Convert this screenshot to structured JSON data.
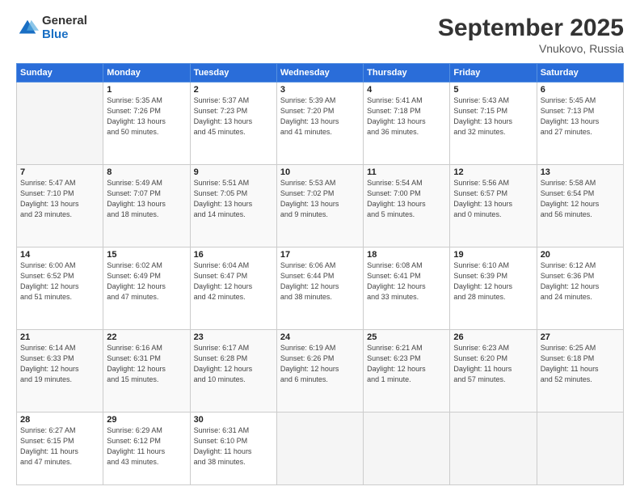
{
  "header": {
    "logo_general": "General",
    "logo_blue": "Blue",
    "month_title": "September 2025",
    "location": "Vnukovo, Russia"
  },
  "days_of_week": [
    "Sunday",
    "Monday",
    "Tuesday",
    "Wednesday",
    "Thursday",
    "Friday",
    "Saturday"
  ],
  "weeks": [
    [
      {
        "day": "",
        "info": ""
      },
      {
        "day": "1",
        "info": "Sunrise: 5:35 AM\nSunset: 7:26 PM\nDaylight: 13 hours\nand 50 minutes."
      },
      {
        "day": "2",
        "info": "Sunrise: 5:37 AM\nSunset: 7:23 PM\nDaylight: 13 hours\nand 45 minutes."
      },
      {
        "day": "3",
        "info": "Sunrise: 5:39 AM\nSunset: 7:20 PM\nDaylight: 13 hours\nand 41 minutes."
      },
      {
        "day": "4",
        "info": "Sunrise: 5:41 AM\nSunset: 7:18 PM\nDaylight: 13 hours\nand 36 minutes."
      },
      {
        "day": "5",
        "info": "Sunrise: 5:43 AM\nSunset: 7:15 PM\nDaylight: 13 hours\nand 32 minutes."
      },
      {
        "day": "6",
        "info": "Sunrise: 5:45 AM\nSunset: 7:13 PM\nDaylight: 13 hours\nand 27 minutes."
      }
    ],
    [
      {
        "day": "7",
        "info": "Sunrise: 5:47 AM\nSunset: 7:10 PM\nDaylight: 13 hours\nand 23 minutes."
      },
      {
        "day": "8",
        "info": "Sunrise: 5:49 AM\nSunset: 7:07 PM\nDaylight: 13 hours\nand 18 minutes."
      },
      {
        "day": "9",
        "info": "Sunrise: 5:51 AM\nSunset: 7:05 PM\nDaylight: 13 hours\nand 14 minutes."
      },
      {
        "day": "10",
        "info": "Sunrise: 5:53 AM\nSunset: 7:02 PM\nDaylight: 13 hours\nand 9 minutes."
      },
      {
        "day": "11",
        "info": "Sunrise: 5:54 AM\nSunset: 7:00 PM\nDaylight: 13 hours\nand 5 minutes."
      },
      {
        "day": "12",
        "info": "Sunrise: 5:56 AM\nSunset: 6:57 PM\nDaylight: 13 hours\nand 0 minutes."
      },
      {
        "day": "13",
        "info": "Sunrise: 5:58 AM\nSunset: 6:54 PM\nDaylight: 12 hours\nand 56 minutes."
      }
    ],
    [
      {
        "day": "14",
        "info": "Sunrise: 6:00 AM\nSunset: 6:52 PM\nDaylight: 12 hours\nand 51 minutes."
      },
      {
        "day": "15",
        "info": "Sunrise: 6:02 AM\nSunset: 6:49 PM\nDaylight: 12 hours\nand 47 minutes."
      },
      {
        "day": "16",
        "info": "Sunrise: 6:04 AM\nSunset: 6:47 PM\nDaylight: 12 hours\nand 42 minutes."
      },
      {
        "day": "17",
        "info": "Sunrise: 6:06 AM\nSunset: 6:44 PM\nDaylight: 12 hours\nand 38 minutes."
      },
      {
        "day": "18",
        "info": "Sunrise: 6:08 AM\nSunset: 6:41 PM\nDaylight: 12 hours\nand 33 minutes."
      },
      {
        "day": "19",
        "info": "Sunrise: 6:10 AM\nSunset: 6:39 PM\nDaylight: 12 hours\nand 28 minutes."
      },
      {
        "day": "20",
        "info": "Sunrise: 6:12 AM\nSunset: 6:36 PM\nDaylight: 12 hours\nand 24 minutes."
      }
    ],
    [
      {
        "day": "21",
        "info": "Sunrise: 6:14 AM\nSunset: 6:33 PM\nDaylight: 12 hours\nand 19 minutes."
      },
      {
        "day": "22",
        "info": "Sunrise: 6:16 AM\nSunset: 6:31 PM\nDaylight: 12 hours\nand 15 minutes."
      },
      {
        "day": "23",
        "info": "Sunrise: 6:17 AM\nSunset: 6:28 PM\nDaylight: 12 hours\nand 10 minutes."
      },
      {
        "day": "24",
        "info": "Sunrise: 6:19 AM\nSunset: 6:26 PM\nDaylight: 12 hours\nand 6 minutes."
      },
      {
        "day": "25",
        "info": "Sunrise: 6:21 AM\nSunset: 6:23 PM\nDaylight: 12 hours\nand 1 minute."
      },
      {
        "day": "26",
        "info": "Sunrise: 6:23 AM\nSunset: 6:20 PM\nDaylight: 11 hours\nand 57 minutes."
      },
      {
        "day": "27",
        "info": "Sunrise: 6:25 AM\nSunset: 6:18 PM\nDaylight: 11 hours\nand 52 minutes."
      }
    ],
    [
      {
        "day": "28",
        "info": "Sunrise: 6:27 AM\nSunset: 6:15 PM\nDaylight: 11 hours\nand 47 minutes."
      },
      {
        "day": "29",
        "info": "Sunrise: 6:29 AM\nSunset: 6:12 PM\nDaylight: 11 hours\nand 43 minutes."
      },
      {
        "day": "30",
        "info": "Sunrise: 6:31 AM\nSunset: 6:10 PM\nDaylight: 11 hours\nand 38 minutes."
      },
      {
        "day": "",
        "info": ""
      },
      {
        "day": "",
        "info": ""
      },
      {
        "day": "",
        "info": ""
      },
      {
        "day": "",
        "info": ""
      }
    ]
  ]
}
